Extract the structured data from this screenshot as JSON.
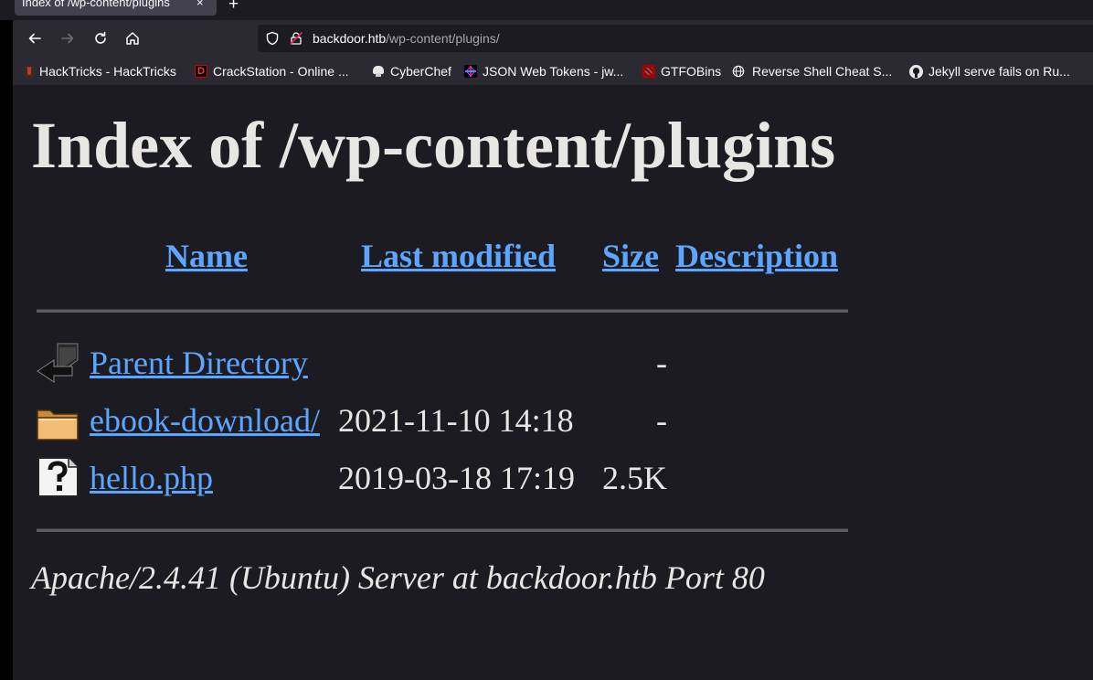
{
  "browser": {
    "tab_title": "Index of /wp-content/plugins",
    "tab_close": "×",
    "new_tab": "+",
    "url_host": "backdoor.htb",
    "url_path": "/wp-content/plugins/",
    "bookmarks": [
      {
        "label": "HackTricks - HackTricks",
        "icon": "hacktricks-icon"
      },
      {
        "label": "CrackStation - Online ...",
        "icon": "crackstation-icon"
      },
      {
        "label": "CyberChef",
        "icon": "cyberchef-icon"
      },
      {
        "label": "JSON Web Tokens - jw...",
        "icon": "jwt-icon"
      },
      {
        "label": "GTFOBins",
        "icon": "gtfobins-icon"
      },
      {
        "label": "Reverse Shell Cheat S...",
        "icon": "globe-icon"
      },
      {
        "label": "Jekyll serve fails on Ru...",
        "icon": "github-icon"
      }
    ]
  },
  "page": {
    "title": "Index of /wp-content/plugins",
    "columns": {
      "name": "Name",
      "last_modified": "Last modified",
      "size": "Size",
      "description": "Description"
    },
    "rows": [
      {
        "icon": "back-icon",
        "name": "Parent Directory",
        "modified": "",
        "size": "-"
      },
      {
        "icon": "folder-icon",
        "name": "ebook-download/",
        "modified": "2021-11-10 14:18",
        "size": "-"
      },
      {
        "icon": "unknown-file-icon",
        "name": "hello.php",
        "modified": "2019-03-18 17:19",
        "size": "2.5K"
      }
    ],
    "footer": "Apache/2.4.41 (Ubuntu) Server at backdoor.htb Port 80"
  },
  "colors": {
    "link": "#5da6ff",
    "page_bg": "#1c1b22",
    "toolbar_bg": "#2b2a33"
  }
}
